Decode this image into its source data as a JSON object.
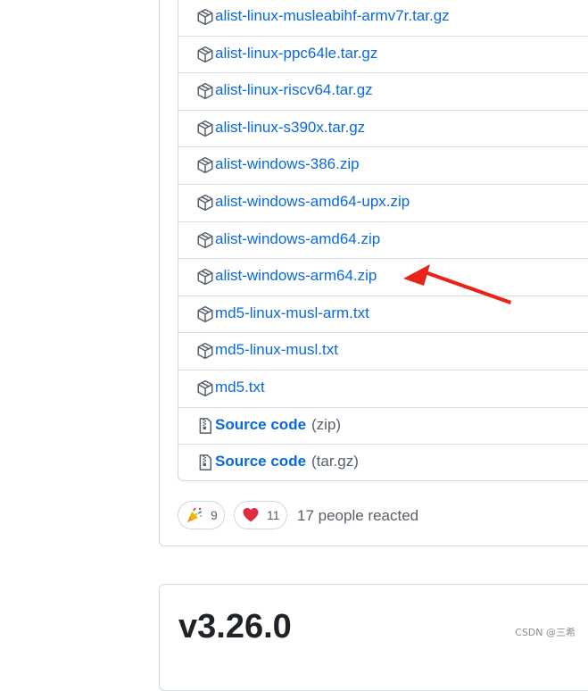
{
  "assets": [
    {
      "name": "alist-linux-musleabihf-armv7r.tar.gz",
      "icon": "package-icon"
    },
    {
      "name": "alist-linux-ppc64le.tar.gz",
      "icon": "package-icon"
    },
    {
      "name": "alist-linux-riscv64.tar.gz",
      "icon": "package-icon"
    },
    {
      "name": "alist-linux-s390x.tar.gz",
      "icon": "package-icon"
    },
    {
      "name": "alist-windows-386.zip",
      "icon": "package-icon"
    },
    {
      "name": "alist-windows-amd64-upx.zip",
      "icon": "package-icon"
    },
    {
      "name": "alist-windows-amd64.zip",
      "icon": "package-icon"
    },
    {
      "name": "alist-windows-arm64.zip",
      "icon": "package-icon"
    },
    {
      "name": "md5-linux-musl-arm.txt",
      "icon": "package-icon"
    },
    {
      "name": "md5-linux-musl.txt",
      "icon": "package-icon"
    },
    {
      "name": "md5.txt",
      "icon": "package-icon"
    }
  ],
  "source_code": [
    {
      "label": "Source code",
      "suffix": "(zip)",
      "icon": "file-zip-icon"
    },
    {
      "label": "Source code",
      "suffix": "(tar.gz)",
      "icon": "file-zip-icon"
    }
  ],
  "reactions": {
    "items": [
      {
        "emoji": "party-popper-icon",
        "count": "9"
      },
      {
        "emoji": "heart-icon",
        "count": "11"
      }
    ],
    "summary": "17 people reacted"
  },
  "next_release": {
    "version": "v3.26.0"
  },
  "watermark": "CSDN @三希",
  "colors": {
    "link": "#0969da",
    "border": "#d0d7de",
    "muted": "#57606a",
    "annotation_arrow": "#e8231a"
  }
}
